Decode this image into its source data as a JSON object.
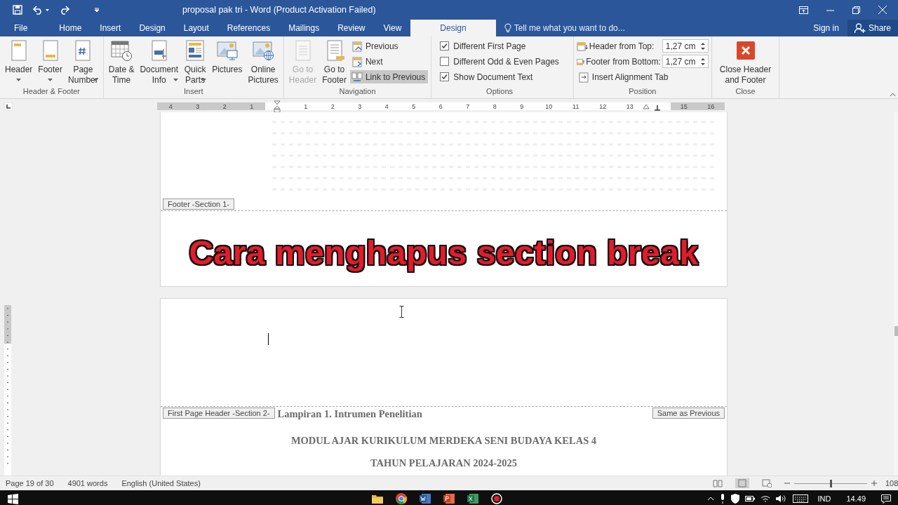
{
  "window": {
    "title": "proposal pak tri - Word (Product Activation Failed)"
  },
  "menu_tabs": [
    {
      "label": "File",
      "selected": false
    },
    {
      "label": "Home",
      "selected": false
    },
    {
      "label": "Insert",
      "selected": false
    },
    {
      "label": "Design",
      "selected": false
    },
    {
      "label": "Layout",
      "selected": false
    },
    {
      "label": "References",
      "selected": false
    },
    {
      "label": "Mailings",
      "selected": false
    },
    {
      "label": "Review",
      "selected": false
    },
    {
      "label": "View",
      "selected": false
    },
    {
      "label": "Design",
      "selected": true
    }
  ],
  "tell_me": {
    "placeholder": "Tell me what you want to do..."
  },
  "account": {
    "sign_in": "Sign in",
    "share": "Share"
  },
  "ribbon": [
    {
      "name": "Header & Footer",
      "items": [
        {
          "kind": "large",
          "lines": [
            "Header"
          ],
          "dropdown": true,
          "disabled": false
        },
        {
          "kind": "large",
          "lines": [
            "Footer"
          ],
          "dropdown": true,
          "disabled": false
        },
        {
          "kind": "large",
          "lines": [
            "Page",
            "Number"
          ],
          "dropdown": true,
          "disabled": false
        }
      ]
    },
    {
      "name": "Insert",
      "items": [
        {
          "kind": "large",
          "lines": [
            "Date &",
            "Time"
          ],
          "disabled": false
        },
        {
          "kind": "large",
          "lines": [
            "Document",
            "Info"
          ],
          "dropdown": true,
          "disabled": false
        },
        {
          "kind": "large",
          "lines": [
            "Quick",
            "Parts"
          ],
          "dropdown": true,
          "disabled": false
        },
        {
          "kind": "large",
          "lines": [
            "Pictures"
          ],
          "disabled": false
        },
        {
          "kind": "large",
          "lines": [
            "Online",
            "Pictures"
          ],
          "disabled": false
        }
      ]
    },
    {
      "name": "Navigation",
      "items": [
        {
          "kind": "large",
          "lines": [
            "Go to",
            "Header"
          ],
          "disabled": true
        },
        {
          "kind": "large",
          "lines": [
            "Go to",
            "Footer"
          ],
          "disabled": false
        },
        {
          "kind": "stack",
          "rows": [
            {
              "kind": "small",
              "label": "Previous",
              "selected": false
            },
            {
              "kind": "small",
              "label": "Next",
              "selected": false
            },
            {
              "kind": "small",
              "label": "Link to Previous",
              "selected": true
            }
          ]
        }
      ]
    },
    {
      "name": "Options",
      "items": [
        {
          "kind": "stack",
          "rows": [
            {
              "kind": "checkbox",
              "label": "Different First Page",
              "checked": true
            },
            {
              "kind": "checkbox",
              "label": "Different Odd & Even Pages",
              "checked": false
            },
            {
              "kind": "checkbox",
              "label": "Show Document Text",
              "checked": true
            }
          ]
        }
      ]
    },
    {
      "name": "Position",
      "items": [
        {
          "kind": "stack",
          "rows": [
            {
              "kind": "spinner",
              "label": "Header from Top:",
              "value": "1,27 cm"
            },
            {
              "kind": "spinner",
              "label": "Footer from Bottom:",
              "value": "1,27 cm"
            },
            {
              "kind": "small",
              "label": "Insert Alignment Tab",
              "selected": false
            }
          ]
        }
      ]
    },
    {
      "name": "Close",
      "items": [
        {
          "kind": "large",
          "lines": [
            "Close Header",
            "and Footer"
          ],
          "disabled": false
        }
      ]
    }
  ],
  "ruler": {
    "left_labels": [
      "4",
      "3",
      "2",
      "1"
    ],
    "labels": [
      "1",
      "2",
      "3",
      "4",
      "5",
      "6",
      "7",
      "8",
      "9",
      "10",
      "11",
      "12",
      "13"
    ],
    "right_labels": [
      "15",
      "16"
    ]
  },
  "pages": [
    {
      "footer_tag": "Footer -Section 1-",
      "caption": "Cara menghapus section break"
    },
    {
      "header_tag": "First Page Header -Section 2-",
      "link_tag": "Same as Previous",
      "lines": [
        {
          "kind": "left",
          "text": "Lampiran 1. Intrumen Penelitian"
        },
        {
          "kind": "center",
          "text": "MODUL AJAR KURIKULUM MERDEKA SENI BUDAYA KELAS 4"
        },
        {
          "kind": "center",
          "text": "TAHUN PELAJARAN 2024-2025"
        }
      ]
    }
  ],
  "status_bar": {
    "page": "Page 19 of 30",
    "words": "4901 words",
    "language": "English (United States)",
    "zoom": {
      "level": 0.5,
      "label": "108"
    }
  },
  "taskbar": {
    "language": "IND",
    "time": "14.49"
  }
}
